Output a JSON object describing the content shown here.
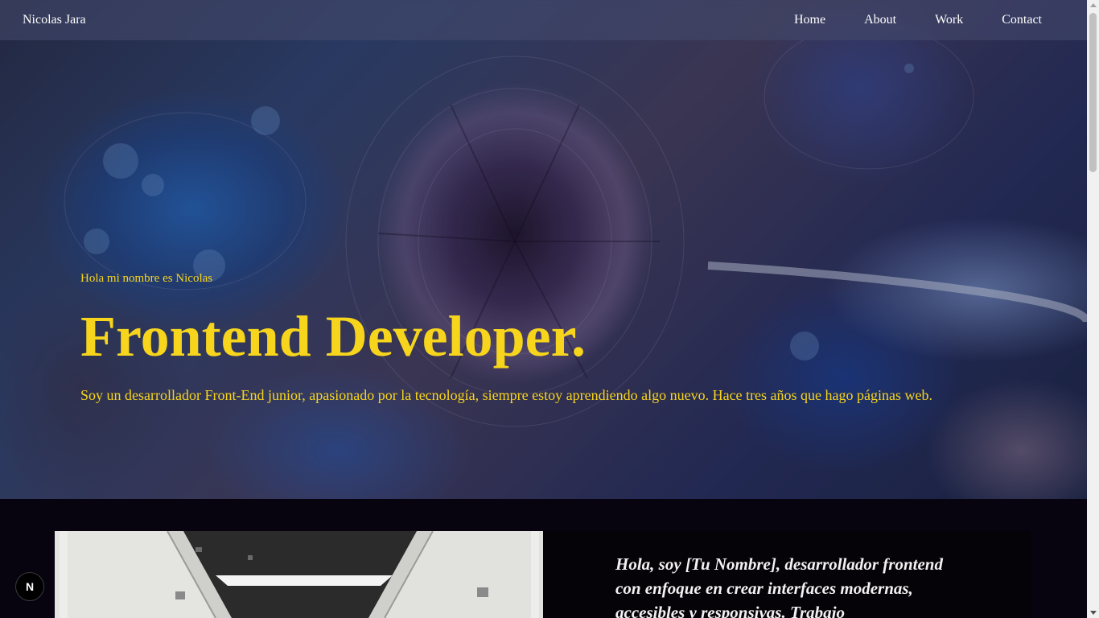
{
  "nav": {
    "brand": "Nicolas Jara",
    "links": [
      "Home",
      "About",
      "Work",
      "Contact"
    ]
  },
  "hero": {
    "greeting": "Hola mi nombre es Nicolas",
    "title": "Frontend Developer.",
    "description": "Soy un desarrollador Front-End junior, apasionado por la tecnología, siempre estoy aprendiendo algo nuevo. Hace tres años que hago páginas web."
  },
  "about": {
    "text": "Hola, soy [Tu Nombre], desarrollador frontend con enfoque en crear interfaces modernas, accesibles y responsivas. Trabajo"
  },
  "dev_indicator": {
    "label": "N"
  },
  "colors": {
    "accent": "#f7d51d",
    "background": "#07040f",
    "nav_text": "#ffffff"
  }
}
